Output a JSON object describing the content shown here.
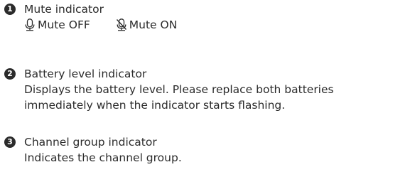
{
  "items": [
    {
      "number": "1",
      "title": "Mute indicator",
      "mute_off_label": "Mute OFF",
      "mute_on_label": "Mute ON",
      "icons": [
        "microphone-icon",
        "microphone-muted-icon"
      ]
    },
    {
      "number": "2",
      "title": "Battery level indicator",
      "desc_line1": "Displays the battery level. Please replace both batteries",
      "desc_line2": "immediately when the indicator starts flashing."
    },
    {
      "number": "3",
      "title": "Channel group indicator",
      "desc_line1": "Indicates the channel group."
    }
  ]
}
